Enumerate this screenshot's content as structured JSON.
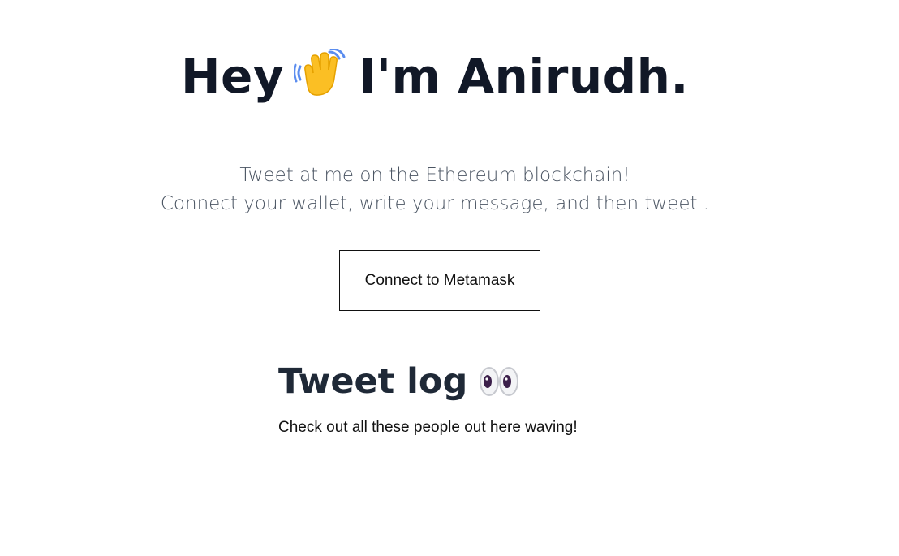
{
  "hero": {
    "heading_before": "Hey",
    "heading_after": "I'm Anirudh.",
    "icon": "waving-hand-icon"
  },
  "subtitle": {
    "line1": "Tweet at me on the Ethereum blockchain!",
    "line2": "Connect your wallet, write your message, and then tweet ."
  },
  "connect_button": {
    "label": "Connect to Metamask"
  },
  "tweet_log": {
    "title": "Tweet log",
    "icon": "eyes-icon",
    "caption": "Check out all these people out here waving!"
  },
  "colors": {
    "heading": "#111827",
    "subtitle": "#4b5563",
    "button_border": "#111111",
    "wave_yellow": "#fbbf24",
    "eyes_pupil": "#3b1f4a"
  }
}
